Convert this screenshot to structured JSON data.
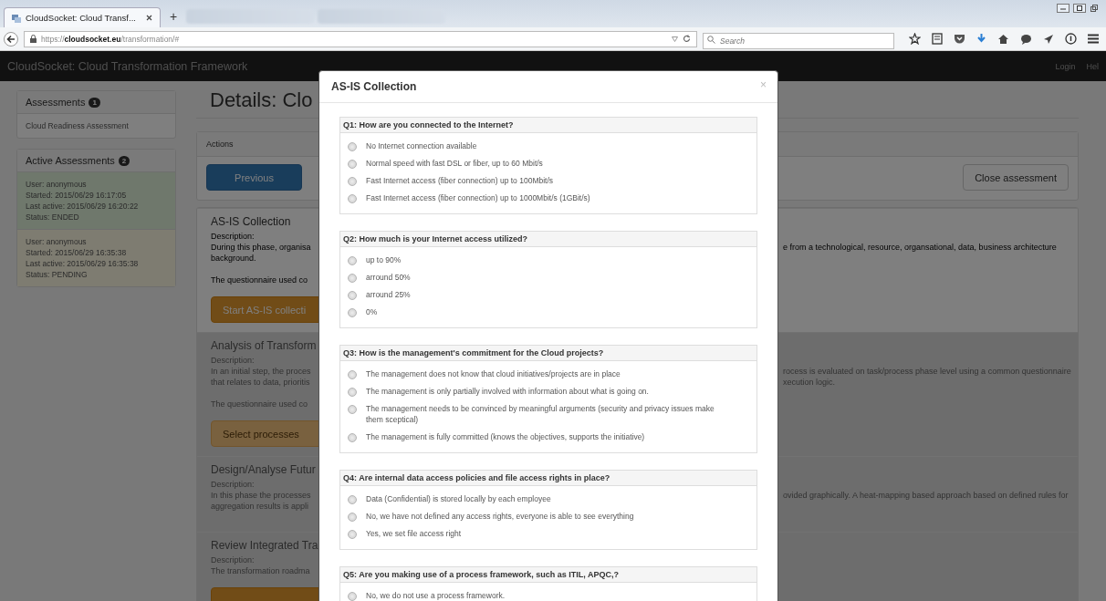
{
  "browser": {
    "tab": {
      "title": "CloudSocket: Cloud Transf...",
      "selected": true
    },
    "new_tab": "+",
    "url": "https://**cloudsocket.eu**/transformation/#",
    "search": {
      "placeholder": "Search"
    }
  },
  "navbar": {
    "brand": "CloudSocket: Cloud Transformation Framework",
    "links": [
      "Login",
      "Hel"
    ]
  },
  "sidebar": {
    "panels": [
      {
        "title": "Assessments",
        "badge": "1",
        "items": [
          {
            "lines": [
              "Cloud Readiness Assessment"
            ]
          }
        ]
      },
      {
        "title": "Active Assessments",
        "badge": "2",
        "items": [
          {
            "lines": [
              "User: anonymous",
              "Started: 2015/06/29 16:17:05",
              "Last active: 2015/06/29 16:20:22",
              "Status: ENDED"
            ],
            "color": "#6f786c"
          },
          {
            "lines": [
              "User: anonymous",
              "Started: 2015/06/29 16:35:38",
              "Last active: 2015/06/29 16:35:38",
              "Status: PENDING"
            ],
            "color": "#7e7c71"
          }
        ]
      }
    ]
  },
  "main": {
    "title": "Details: Clo",
    "actions": {
      "heading": "Actions",
      "buttons": [
        {
          "label": "Previous",
          "kind": "primary"
        },
        {
          "label": "Close assessment",
          "kind": "default"
        }
      ]
    },
    "sections": [
      {
        "title": "AS-IS Collection",
        "disabled": false,
        "label": "Description:",
        "paragraphs": [
          [
            {
              "left": "During this phase, organisa",
              "right": "e from a technological, resource, organsational, data, business architecture"
            },
            {
              "left": "background."
            }
          ],
          [
            {
              "left": "The questionnaire used co"
            }
          ]
        ],
        "button": {
          "label": "Start AS-IS collecti",
          "disabled": false
        }
      },
      {
        "title": "Analysis of Transform",
        "disabled": true,
        "label": "Description:",
        "paragraphs": [
          [
            {
              "left": "In an initial step, the proces",
              "right": "rocess is evaluated on task/process phase level using a common questionnaire"
            },
            {
              "left": "that relates to data, prioritis",
              "right": "xecution logic."
            }
          ],
          [
            {
              "left": "The questionnaire used co"
            }
          ]
        ],
        "button": {
          "label": "Select processes",
          "disabled": true
        }
      },
      {
        "title": "Design/Analyse Futur",
        "disabled": true,
        "label": "Description:",
        "paragraphs": [
          [
            {
              "left": "In this phase the processes",
              "right": "ovided graphically. A heat-mapping based approach based on defined rules for"
            },
            {
              "left": "aggregation results is appli"
            }
          ]
        ]
      },
      {
        "title": "Review Integrated Tra",
        "disabled": true,
        "label": "Description:",
        "paragraphs": [
          [
            {
              "left": "The transformation roadma"
            }
          ]
        ],
        "button": {
          "disabled": false
        }
      }
    ]
  },
  "modal": {
    "title": "AS-IS Collection",
    "close": "×",
    "questions": [
      {
        "title": "Q1: How are you connected to the Internet?",
        "options": [
          {
            "label": "No Internet connection available",
            "selected": false
          },
          {
            "label": "Normal speed with fast DSL or fiber, up to 60 Mbit/s",
            "selected": false
          },
          {
            "label": "Fast Internet access (fiber connection) up to 100Mbit/s",
            "selected": false
          },
          {
            "label": "Fast Internet access (fiber connection) up to 1000Mbit/s (1GBit/s)",
            "selected": false
          }
        ]
      },
      {
        "title": "Q2: How much is your Internet access utilized?",
        "options": [
          {
            "label": "up to 90%",
            "selected": false
          },
          {
            "label": "arround 50%",
            "selected": false
          },
          {
            "label": "arround 25%",
            "selected": false
          },
          {
            "label": "0%",
            "selected": false
          }
        ]
      },
      {
        "title": "Q3: How is the management's commitment for the Cloud projects?",
        "options": [
          {
            "label": "The management does not know that cloud initiatives/projects are in place",
            "selected": false
          },
          {
            "label": "The management is only partially involved with information about what is going on.",
            "selected": false
          },
          {
            "label": "The management needs to be convinced by meaningful arguments (security and privacy issues make them sceptical)",
            "selected": false
          },
          {
            "label": "The management is fully committed (knows the objectives, supports the initiative)",
            "selected": false
          }
        ]
      },
      {
        "title": "Q4: Are internal data access policies and file access rights in place?",
        "options": [
          {
            "label": "Data (Confidential) is stored locally by each employee",
            "selected": false
          },
          {
            "label": "No, we have not defined any access rights, everyone is able to see everything",
            "selected": false
          },
          {
            "label": "Yes, we set file access right",
            "selected": false
          }
        ]
      },
      {
        "title": "Q5: Are you making use of a process framework, such as ITIL, APQC,?",
        "options": [
          {
            "label": "No, we do not use a process framework.",
            "selected": false
          }
        ]
      }
    ]
  }
}
